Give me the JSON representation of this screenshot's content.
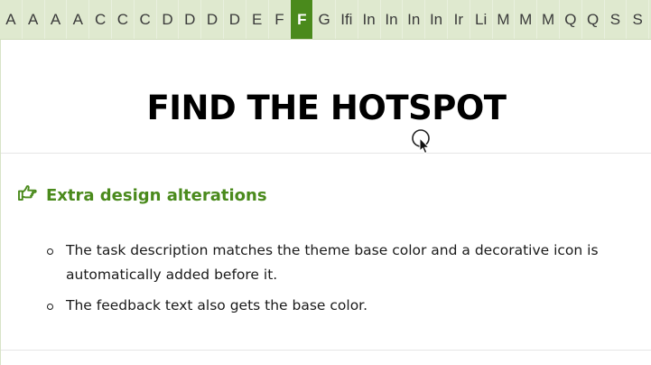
{
  "tabs": {
    "items": [
      "A",
      "A",
      "A",
      "A",
      "C",
      "C",
      "C",
      "D",
      "D",
      "D",
      "D",
      "E",
      "F",
      "F",
      "G",
      "Ifi",
      "In",
      "In",
      "In",
      "In",
      "Ir",
      "Li",
      "M",
      "M",
      "M",
      "Q",
      "Q",
      "S",
      "S"
    ],
    "active_index": 13
  },
  "main": {
    "title": "FIND THE HOTSPOT",
    "task_icon": "pointing-hand-icon",
    "task_text": "Extra design alterations",
    "bullets": [
      "The task description matches the theme base color and a decorative icon is automatically added before it.",
      "The feedback text also gets the base color."
    ]
  },
  "colors": {
    "accent": "#4a8a1c",
    "tabbar_bg": "#dfe9cf"
  }
}
